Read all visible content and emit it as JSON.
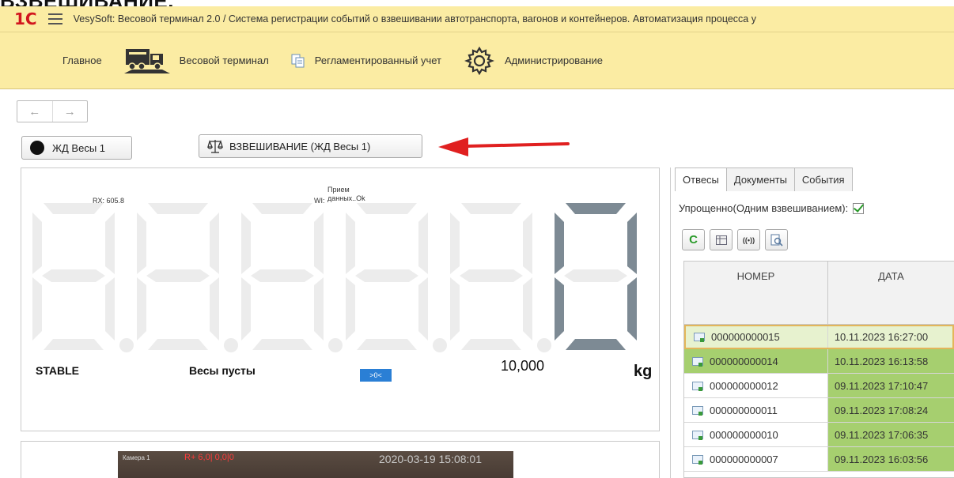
{
  "heading": "ВЗВЕШИВАНИЕ.",
  "colors": {
    "accent_yellow": "#fbeca3",
    "brand_red": "#d2161e",
    "digit_lit": "#7d8a94",
    "digit_dim": "#ececec",
    "row_green": "#a6cf6f",
    "row_lightgreen": "#d9ebbd",
    "row_selected": "#e7f2cf"
  },
  "titlebar": {
    "logo": "1С",
    "menu_icon": "hamburger-icon",
    "title": "VesySoft: Весовой терминал 2.0 / Система регистрации событий о взвешивании автотранспорта, вагонов и контейнеров. Автоматизация процесса у"
  },
  "sections": [
    {
      "icon": "hamburger-icon",
      "label": "Главное"
    },
    {
      "icon": "truck-icon",
      "label": "Весовой терминал"
    },
    {
      "icon": "documents-icon",
      "label": "Регламентированный учет"
    },
    {
      "icon": "gear-icon",
      "label": "Администрирование"
    }
  ],
  "nav": {
    "back": "←",
    "forward": "→"
  },
  "buttons": {
    "scale_select": "ЖД Весы 1",
    "weighing": "ВЗВЕШИВАНИЕ (ЖД Весы 1)"
  },
  "scale": {
    "rx_label": "RX: 605.8",
    "wi_prefix": "WI:",
    "wi_line1": "Прием",
    "wi_line2": "данных..Ok",
    "display_value": "0",
    "status_stable": "STABLE",
    "status_empty": "Весы пусты",
    "zero_indicator": ">0<",
    "max_value": "10,000",
    "unit": "kg"
  },
  "camera": {
    "cam_label": "Камера 1",
    "overlay": "R+ 6,0| 0,0|0",
    "timestamp": "2020-03-19 15:08:01"
  },
  "right": {
    "tabs": [
      "Отвесы",
      "Документы",
      "События"
    ],
    "active_tab": 0,
    "simple_label": "Упрощенно(Одним взвешиванием):",
    "simple_checked": true,
    "toolbar": [
      "refresh-icon",
      "table-icon",
      "wireless-icon",
      "preview-icon"
    ],
    "refresh_glyph": "C",
    "wireless_glyph": "((•))",
    "columns": [
      "НОМЕР",
      "ДАТА"
    ],
    "rows": [
      {
        "num": "000000000015",
        "date": "10.11.2023 16:27:00",
        "state": "selected"
      },
      {
        "num": "000000000014",
        "date": "10.11.2023 16:13:58",
        "state": "green"
      },
      {
        "num": "000000000012",
        "date": "09.11.2023 17:10:47",
        "state": "half"
      },
      {
        "num": "000000000011",
        "date": "09.11.2023 17:08:24",
        "state": "half"
      },
      {
        "num": "000000000010",
        "date": "09.11.2023 17:06:35",
        "state": "half"
      },
      {
        "num": "000000000007",
        "date": "09.11.2023 16:03:56",
        "state": "half"
      }
    ]
  }
}
